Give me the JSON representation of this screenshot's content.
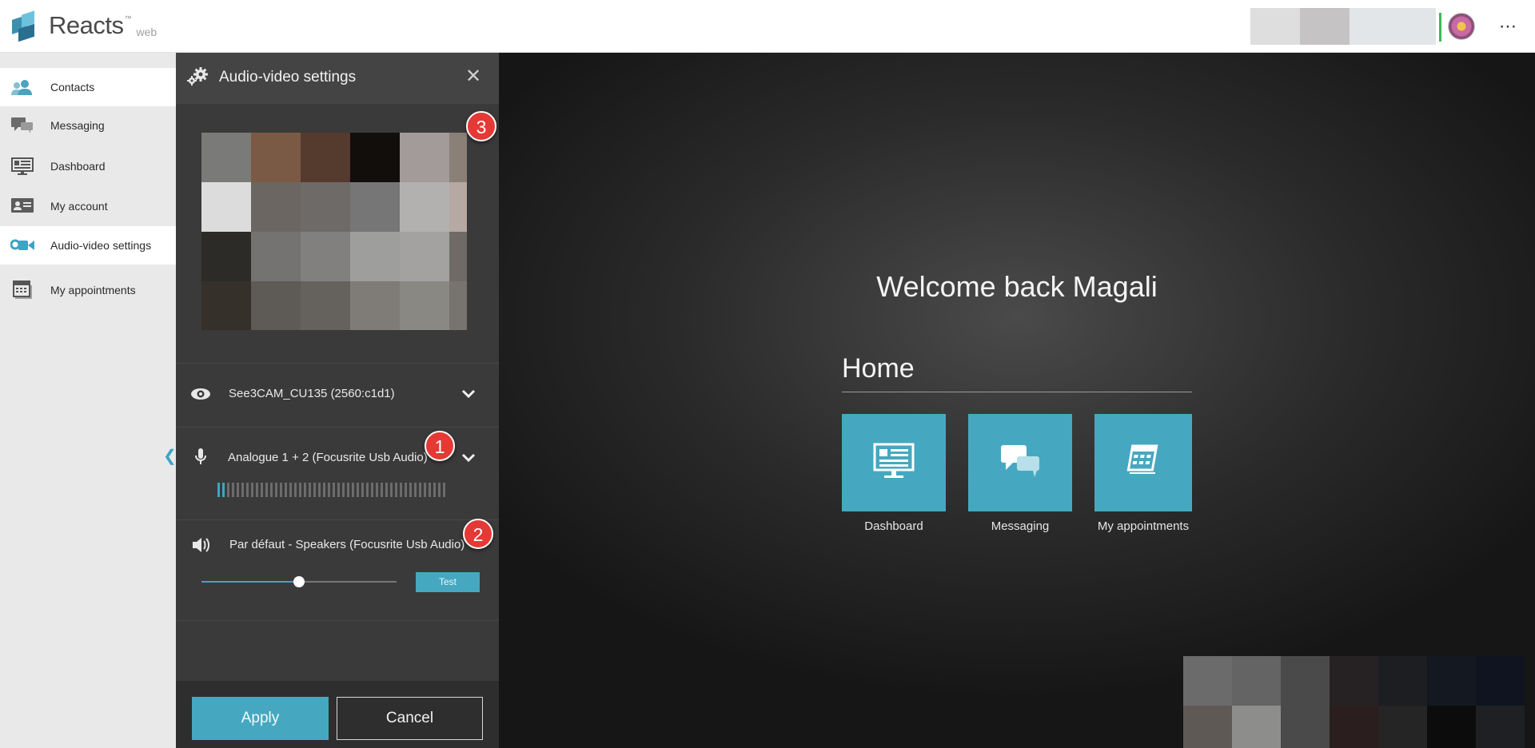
{
  "app": {
    "name": "Reacts",
    "trademark": "™",
    "platform": "web"
  },
  "topbar": {
    "user_swatches": [
      "#dedede",
      "#c5c3c3",
      "#e3e6e8"
    ],
    "status_color": "#3cba54",
    "more_label": "⋯"
  },
  "sidebar": {
    "items": [
      {
        "label": "Contacts",
        "icon": "contacts-icon",
        "active": true
      },
      {
        "label": "Messaging",
        "icon": "messaging-icon"
      },
      {
        "label": "Dashboard",
        "icon": "dashboard-icon"
      },
      {
        "label": "My account",
        "icon": "account-icon"
      },
      {
        "label": "Audio-video settings",
        "icon": "camera-icon",
        "active": true
      },
      {
        "label": "My appointments",
        "icon": "calendar-icon"
      }
    ],
    "collapse_glyph": "❮"
  },
  "panel": {
    "title": "Audio-video settings",
    "close_glyph": "✕",
    "camera": {
      "device": "See3CAM_CU135 (2560:c1d1)"
    },
    "microphone": {
      "device": "Analogue 1 + 2 (Focusrite Usb Audio)",
      "level": 0.08
    },
    "speaker": {
      "device": "Par défaut - Speakers (Focusrite Usb Audio)",
      "volume": 0.5,
      "test_label": "Test"
    },
    "apply_label": "Apply",
    "cancel_label": "Cancel",
    "annotations": [
      "1",
      "2",
      "3"
    ]
  },
  "main": {
    "welcome": "Welcome back Magali",
    "home_title": "Home",
    "tiles": [
      {
        "label": "Dashboard",
        "icon": "dashboard-icon"
      },
      {
        "label": "Messaging",
        "icon": "messaging-icon"
      },
      {
        "label": "My appointments",
        "icon": "calendar-icon"
      }
    ]
  },
  "colors": {
    "accent": "#46a8c0",
    "annotation": "#e53935"
  },
  "preview_pixels": [
    [
      "#7a7a78",
      "#7a5a44",
      "#553a2e",
      "#120e0c",
      "#a39b99",
      "#8a8078"
    ],
    [
      "#dcdcdc",
      "#6b6662",
      "#6d6a67",
      "#777676",
      "#b2b1b0",
      "#b6a8a2"
    ],
    [
      "#2d2b28",
      "#747371",
      "#81807e",
      "#9e9e9c",
      "#a3a2a0",
      "#6f6a65"
    ],
    [
      "#35302a",
      "#5e5b57",
      "#65625e",
      "#7f7b77",
      "#8a8883",
      "#77746f"
    ]
  ],
  "selfview_pixels": [
    [
      "#6b6b6b",
      "#646464",
      "#4a4a4a",
      "#262223",
      "#1d1e22",
      "#141821",
      "#0f1420"
    ],
    [
      "#5e5954",
      "#8d8d8b",
      "#4a4a4a",
      "#2a1e1f",
      "#262526",
      "#0c0c0c",
      "#1e2023"
    ]
  ]
}
